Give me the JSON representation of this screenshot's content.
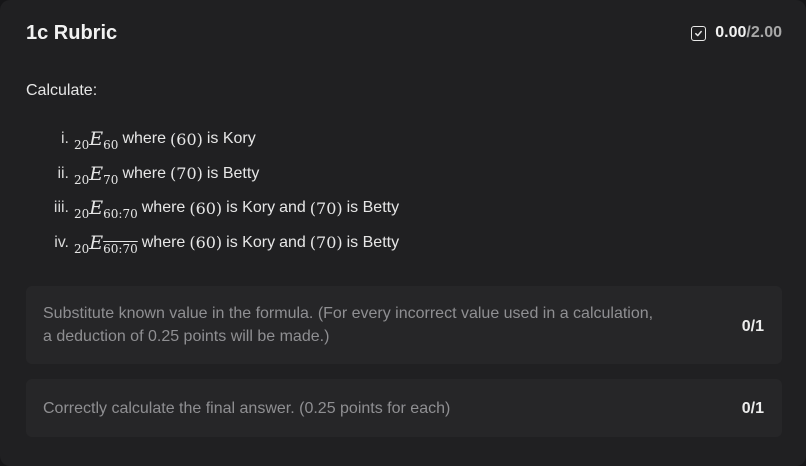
{
  "rubric": {
    "title": "1c Rubric",
    "score_earned": "0.00",
    "score_total": "/2.00",
    "score_icon": "checkbox-icon"
  },
  "question": {
    "intro": "Calculate:",
    "items": [
      {
        "num": "i.",
        "pre": "20",
        "letter": "E",
        "subscript": "60",
        "where": "where",
        "arg1": "(60)",
        "text1": "is Kory",
        "and": "",
        "arg2": "",
        "text2": ""
      },
      {
        "num": "ii.",
        "pre": "20",
        "letter": "E",
        "subscript": "70",
        "where": "where",
        "arg1": "(70)",
        "text1": "is Betty",
        "and": "",
        "arg2": "",
        "text2": ""
      },
      {
        "num": "iii.",
        "pre": "20",
        "letter": "E",
        "subscript": "60:70",
        "where": "where",
        "arg1": "(60)",
        "text1": "is Kory",
        "and": "and",
        "arg2": "(70)",
        "text2": "is Betty"
      },
      {
        "num": "iv.",
        "pre": "20",
        "letter": "E",
        "subscript": "60:70",
        "where": "where",
        "arg1": "(60)",
        "text1": "is Kory",
        "and": "and",
        "arg2": "(70)",
        "text2": "is Betty"
      }
    ]
  },
  "criteria": [
    {
      "line1": "Substitute known value in the formula. (For every incorrect value used in a calculation,",
      "line2": "a deduction of 0.25 points will be made.)",
      "points": "0/1"
    },
    {
      "line1": "Correctly calculate the final answer. (0.25 points for each)",
      "points": "0/1"
    }
  ],
  "colors": {
    "background": "#202022",
    "criterion_background": "#262628",
    "muted_text": "#8f8f92"
  }
}
